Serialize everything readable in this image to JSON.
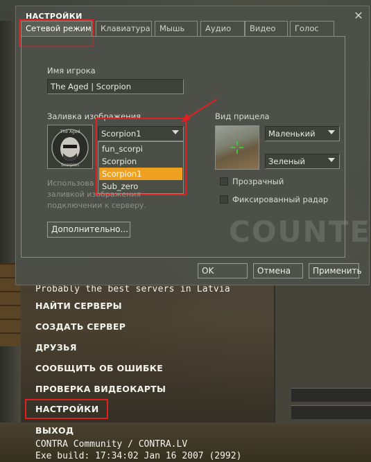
{
  "dialog": {
    "title": "НАСТРОЙКИ",
    "close_glyph": "✕",
    "tabs": [
      {
        "label": "Сетевой режим",
        "active": true
      },
      {
        "label": "Клавиатура",
        "active": false
      },
      {
        "label": "Мышь",
        "active": false
      },
      {
        "label": "Аудио",
        "active": false
      },
      {
        "label": "Видео",
        "active": false
      },
      {
        "label": "Голос",
        "active": false
      }
    ],
    "player_name_label": "Имя игрока",
    "player_name_value": "The Aged | Scorpion",
    "spray_label": "Заливка изображения",
    "spray_selected": "Scorpion1",
    "spray_options": [
      "fun_scorpi",
      "Scorpion",
      "Scorpion1",
      "Sub_zero"
    ],
    "spray_highlighted_index": 2,
    "spray_logo_text_top": "The Aged",
    "spray_logo_text_bottom": "Scorpion",
    "hint_line1_visible": "Использова",
    "hint_line2_visible": "заливкой изображения",
    "hint_line3": "подключении к серверу.",
    "advanced_button": "Дополнительно...",
    "crosshair_label": "Вид прицела",
    "crosshair_size": "Маленький",
    "crosshair_color": "Зеленый",
    "transparent_label": "Прозрачный",
    "fixed_radar_label": "Фиксированный радар",
    "transparent_checked": false,
    "fixed_radar_checked": false,
    "watermark": "COUNTER",
    "buttons": {
      "ok": "OK",
      "cancel": "Отмена",
      "apply": "Применить"
    }
  },
  "menu": {
    "tagline": "Probably the best servers in Latvia",
    "items": [
      "НАЙТИ СЕРВЕРЫ",
      "СОЗДАТЬ СЕРВЕР",
      "ДРУЗЬЯ",
      "СООБЩИТЬ ОБ ОШИБКЕ",
      "ПРОВЕРКА ВИДЕОКАРТЫ",
      "НАСТРОЙКИ",
      "ВЫХОД"
    ],
    "selected_index": 5
  },
  "footer": {
    "line1": "CONTRA Community / CONTRA.LV",
    "line2": "Exe build: 17:34:02 Jan 16 2007 (2992)"
  },
  "colors": {
    "annotation_red": "#e02020",
    "highlight_orange": "#f0a020"
  }
}
